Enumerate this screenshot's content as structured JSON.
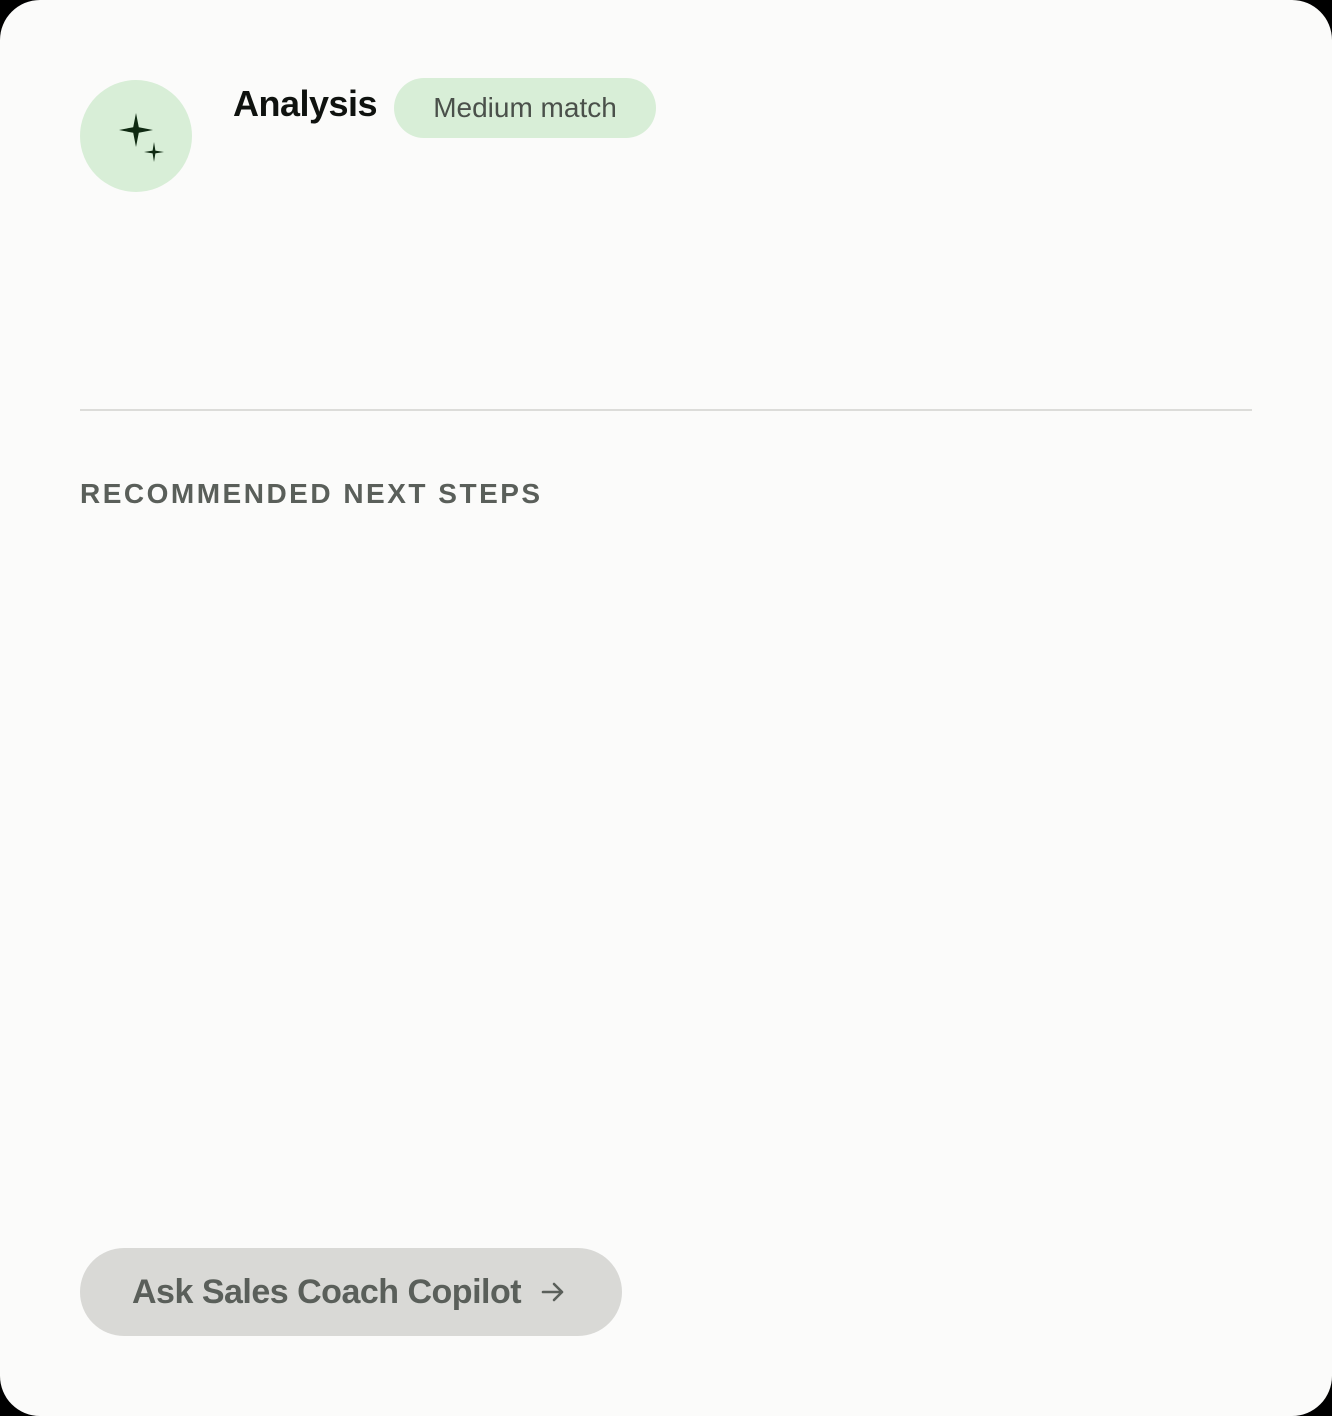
{
  "header": {
    "icon": "sparkles-icon",
    "title": "Analysis",
    "badge": "Medium match"
  },
  "section": {
    "heading": "RECOMMENDED NEXT STEPS"
  },
  "cta": {
    "label": "Ask Sales Coach Copilot",
    "icon": "arrow-right-icon"
  },
  "colors": {
    "background": "#fbfbfa",
    "accent_green": "#d8eed7",
    "icon_dark": "#0f2a12",
    "button_gray": "#d9d9d6",
    "muted_text": "#5a5f5a"
  }
}
